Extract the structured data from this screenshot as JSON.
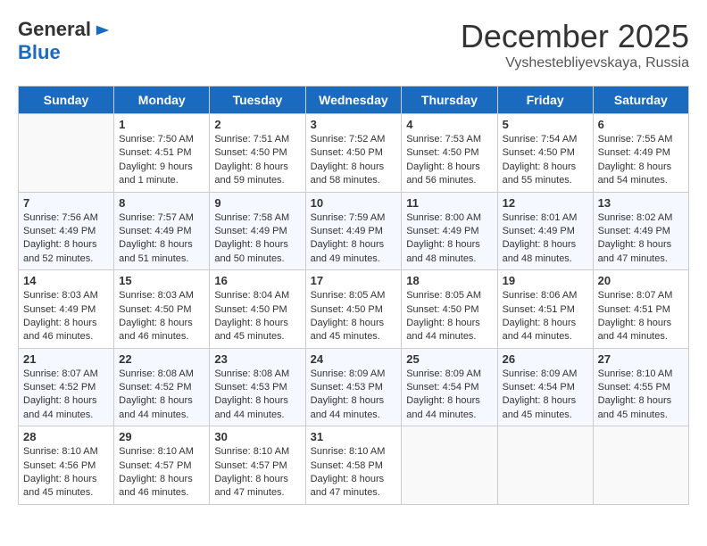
{
  "header": {
    "logo": {
      "general": "General",
      "blue": "Blue"
    },
    "title": "December 2025",
    "location": "Vyshestebliyevskaya, Russia"
  },
  "days_of_week": [
    "Sunday",
    "Monday",
    "Tuesday",
    "Wednesday",
    "Thursday",
    "Friday",
    "Saturday"
  ],
  "weeks": [
    [
      {
        "day": "",
        "content": ""
      },
      {
        "day": "1",
        "content": "Sunrise: 7:50 AM\nSunset: 4:51 PM\nDaylight: 9 hours\nand 1 minute."
      },
      {
        "day": "2",
        "content": "Sunrise: 7:51 AM\nSunset: 4:50 PM\nDaylight: 8 hours\nand 59 minutes."
      },
      {
        "day": "3",
        "content": "Sunrise: 7:52 AM\nSunset: 4:50 PM\nDaylight: 8 hours\nand 58 minutes."
      },
      {
        "day": "4",
        "content": "Sunrise: 7:53 AM\nSunset: 4:50 PM\nDaylight: 8 hours\nand 56 minutes."
      },
      {
        "day": "5",
        "content": "Sunrise: 7:54 AM\nSunset: 4:50 PM\nDaylight: 8 hours\nand 55 minutes."
      },
      {
        "day": "6",
        "content": "Sunrise: 7:55 AM\nSunset: 4:49 PM\nDaylight: 8 hours\nand 54 minutes."
      }
    ],
    [
      {
        "day": "7",
        "content": "Sunrise: 7:56 AM\nSunset: 4:49 PM\nDaylight: 8 hours\nand 52 minutes."
      },
      {
        "day": "8",
        "content": "Sunrise: 7:57 AM\nSunset: 4:49 PM\nDaylight: 8 hours\nand 51 minutes."
      },
      {
        "day": "9",
        "content": "Sunrise: 7:58 AM\nSunset: 4:49 PM\nDaylight: 8 hours\nand 50 minutes."
      },
      {
        "day": "10",
        "content": "Sunrise: 7:59 AM\nSunset: 4:49 PM\nDaylight: 8 hours\nand 49 minutes."
      },
      {
        "day": "11",
        "content": "Sunrise: 8:00 AM\nSunset: 4:49 PM\nDaylight: 8 hours\nand 48 minutes."
      },
      {
        "day": "12",
        "content": "Sunrise: 8:01 AM\nSunset: 4:49 PM\nDaylight: 8 hours\nand 48 minutes."
      },
      {
        "day": "13",
        "content": "Sunrise: 8:02 AM\nSunset: 4:49 PM\nDaylight: 8 hours\nand 47 minutes."
      }
    ],
    [
      {
        "day": "14",
        "content": "Sunrise: 8:03 AM\nSunset: 4:49 PM\nDaylight: 8 hours\nand 46 minutes."
      },
      {
        "day": "15",
        "content": "Sunrise: 8:03 AM\nSunset: 4:50 PM\nDaylight: 8 hours\nand 46 minutes."
      },
      {
        "day": "16",
        "content": "Sunrise: 8:04 AM\nSunset: 4:50 PM\nDaylight: 8 hours\nand 45 minutes."
      },
      {
        "day": "17",
        "content": "Sunrise: 8:05 AM\nSunset: 4:50 PM\nDaylight: 8 hours\nand 45 minutes."
      },
      {
        "day": "18",
        "content": "Sunrise: 8:05 AM\nSunset: 4:50 PM\nDaylight: 8 hours\nand 44 minutes."
      },
      {
        "day": "19",
        "content": "Sunrise: 8:06 AM\nSunset: 4:51 PM\nDaylight: 8 hours\nand 44 minutes."
      },
      {
        "day": "20",
        "content": "Sunrise: 8:07 AM\nSunset: 4:51 PM\nDaylight: 8 hours\nand 44 minutes."
      }
    ],
    [
      {
        "day": "21",
        "content": "Sunrise: 8:07 AM\nSunset: 4:52 PM\nDaylight: 8 hours\nand 44 minutes."
      },
      {
        "day": "22",
        "content": "Sunrise: 8:08 AM\nSunset: 4:52 PM\nDaylight: 8 hours\nand 44 minutes."
      },
      {
        "day": "23",
        "content": "Sunrise: 8:08 AM\nSunset: 4:53 PM\nDaylight: 8 hours\nand 44 minutes."
      },
      {
        "day": "24",
        "content": "Sunrise: 8:09 AM\nSunset: 4:53 PM\nDaylight: 8 hours\nand 44 minutes."
      },
      {
        "day": "25",
        "content": "Sunrise: 8:09 AM\nSunset: 4:54 PM\nDaylight: 8 hours\nand 44 minutes."
      },
      {
        "day": "26",
        "content": "Sunrise: 8:09 AM\nSunset: 4:54 PM\nDaylight: 8 hours\nand 45 minutes."
      },
      {
        "day": "27",
        "content": "Sunrise: 8:10 AM\nSunset: 4:55 PM\nDaylight: 8 hours\nand 45 minutes."
      }
    ],
    [
      {
        "day": "28",
        "content": "Sunrise: 8:10 AM\nSunset: 4:56 PM\nDaylight: 8 hours\nand 45 minutes."
      },
      {
        "day": "29",
        "content": "Sunrise: 8:10 AM\nSunset: 4:57 PM\nDaylight: 8 hours\nand 46 minutes."
      },
      {
        "day": "30",
        "content": "Sunrise: 8:10 AM\nSunset: 4:57 PM\nDaylight: 8 hours\nand 47 minutes."
      },
      {
        "day": "31",
        "content": "Sunrise: 8:10 AM\nSunset: 4:58 PM\nDaylight: 8 hours\nand 47 minutes."
      },
      {
        "day": "",
        "content": ""
      },
      {
        "day": "",
        "content": ""
      },
      {
        "day": "",
        "content": ""
      }
    ]
  ]
}
